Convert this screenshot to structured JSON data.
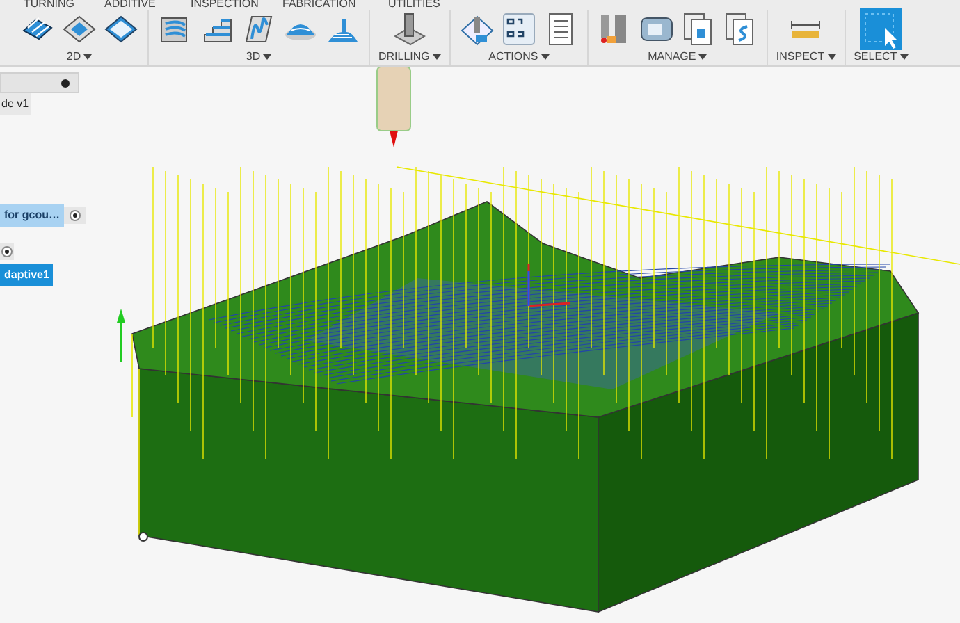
{
  "tabs": [
    {
      "label": "TURNING"
    },
    {
      "label": "ADDITIVE"
    },
    {
      "label": "INSPECTION"
    },
    {
      "label": "FABRICATION"
    },
    {
      "label": "UTILITIES"
    }
  ],
  "groups": [
    {
      "label": "2D",
      "icons": [
        {
          "kind": "layers"
        },
        {
          "kind": "pocket"
        },
        {
          "kind": "face"
        }
      ]
    },
    {
      "label": "3D",
      "icons": [
        {
          "kind": "adaptive"
        },
        {
          "kind": "steps"
        },
        {
          "kind": "contour"
        },
        {
          "kind": "dome"
        },
        {
          "kind": "scallop"
        }
      ]
    },
    {
      "label": "DRILLING",
      "icons": [
        {
          "kind": "drill"
        }
      ]
    },
    {
      "label": "ACTIONS",
      "icons": [
        {
          "kind": "simulate"
        },
        {
          "kind": "gcode"
        },
        {
          "kind": "sheet"
        }
      ]
    },
    {
      "label": "MANAGE",
      "icons": [
        {
          "kind": "tools"
        },
        {
          "kind": "machine"
        },
        {
          "kind": "gpage"
        },
        {
          "kind": "spage"
        }
      ]
    },
    {
      "label": "INSPECT",
      "icons": [
        {
          "kind": "ruler"
        }
      ]
    },
    {
      "label": "SELECT",
      "icons": [
        {
          "kind": "select"
        }
      ]
    }
  ],
  "browser": [
    {
      "kind": "field"
    },
    {
      "kind": "label",
      "text": "de v1"
    },
    {
      "kind": "item",
      "text": "for gcou…",
      "active": false
    },
    {
      "kind": "toggle"
    },
    {
      "kind": "item",
      "text": "daptive1",
      "active": true
    }
  ]
}
